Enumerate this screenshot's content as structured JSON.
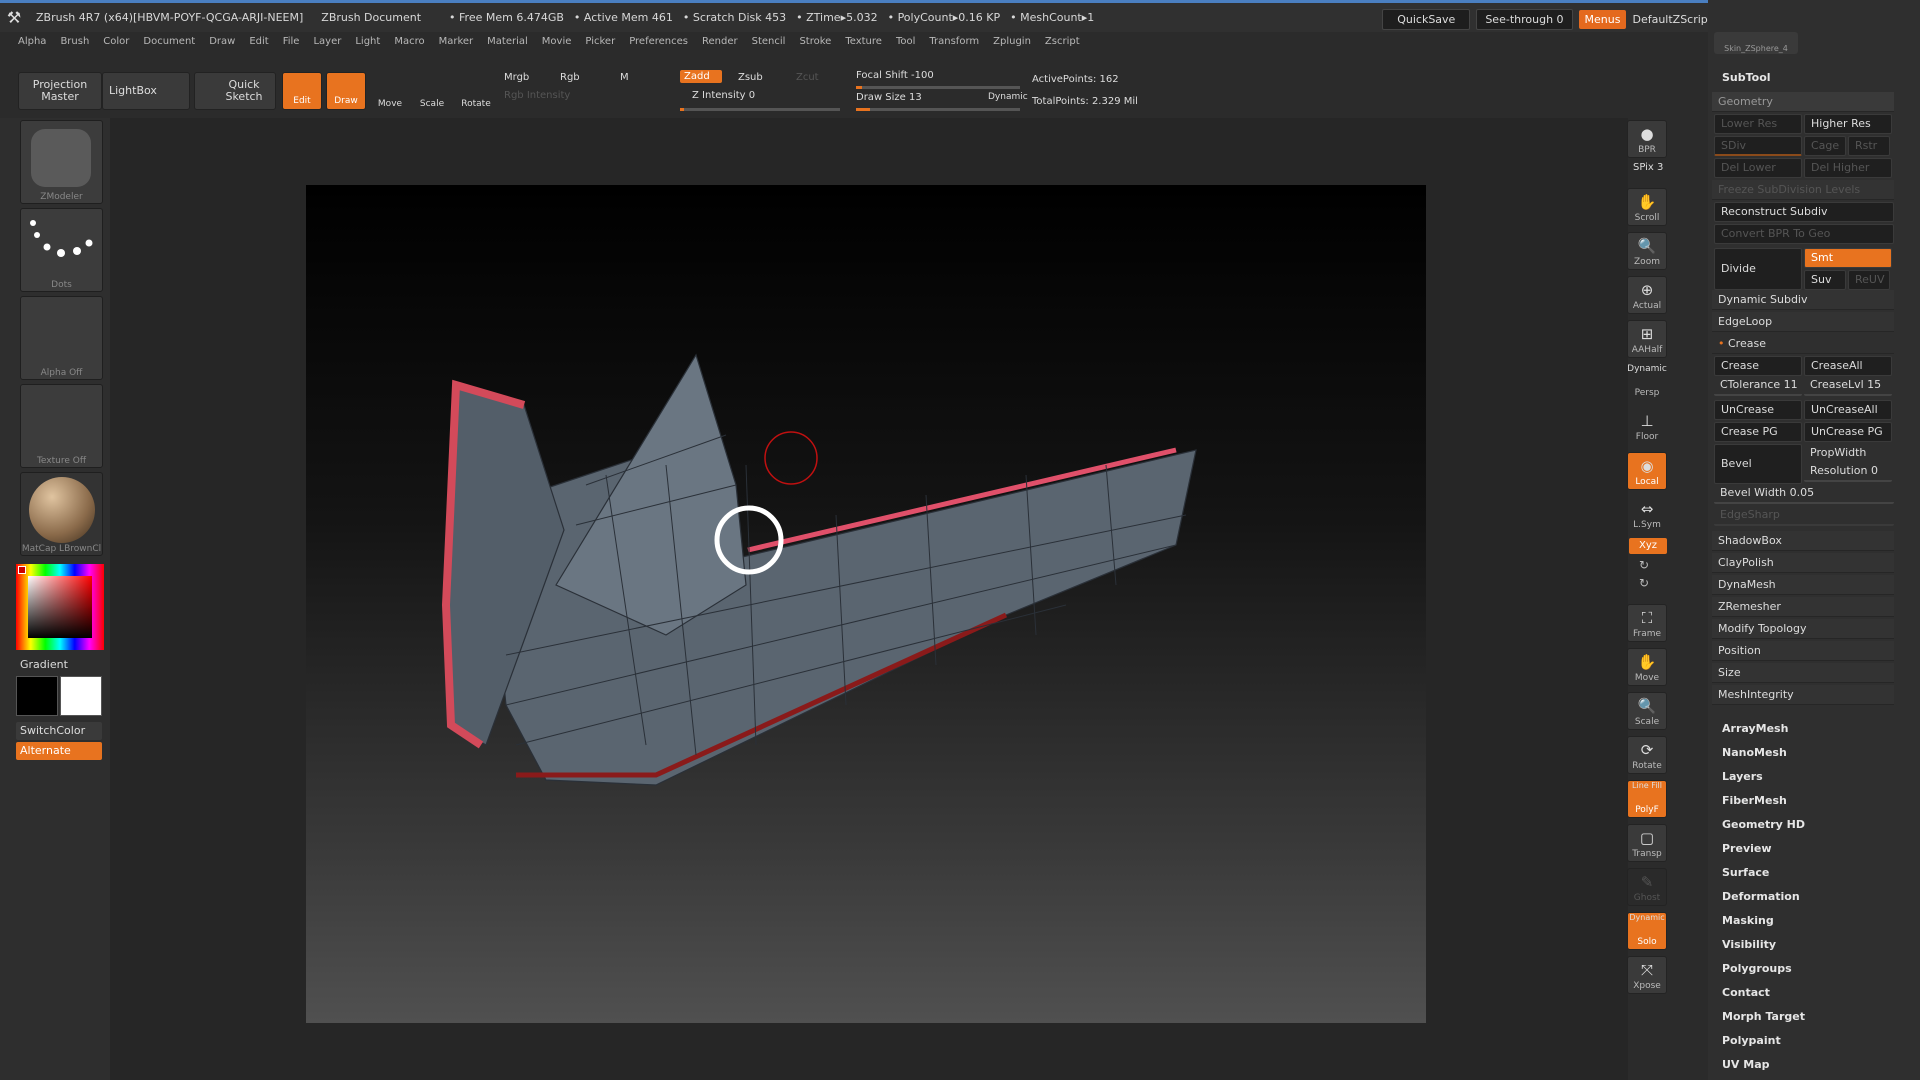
{
  "titlebar": {
    "app": "ZBrush 4R7 (x64)[HBVM-POYF-QCGA-ARJI-NEEM]",
    "doc": "ZBrush Document",
    "free_mem": "• Free Mem 6.474GB",
    "active_mem": "• Active Mem 461",
    "scratch": "• Scratch Disk 453",
    "ztime": "• ZTime▸5.032",
    "polycount": "• PolyCount▸0.16 KP",
    "meshcount": "• MeshCount▸1",
    "quicksave": "QuickSave",
    "see_through": "See-through  0",
    "menus": "Menus",
    "default_zscript": "DefaultZScript"
  },
  "menubar": [
    "Alpha",
    "Brush",
    "Color",
    "Document",
    "Draw",
    "Edit",
    "File",
    "Layer",
    "Light",
    "Macro",
    "Marker",
    "Material",
    "Movie",
    "Picker",
    "Preferences",
    "Render",
    "Stencil",
    "Stroke",
    "Texture",
    "Tool",
    "Transform",
    "Zplugin",
    "Zscript"
  ],
  "toolbar": {
    "projection_master": "Projection Master",
    "lightbox": "LightBox",
    "quick_sketch": "Quick Sketch",
    "edit": "Edit",
    "draw": "Draw",
    "move": "Move",
    "scale": "Scale",
    "rotate": "Rotate",
    "mrgb": "Mrgb",
    "rgb": "Rgb",
    "m": "M",
    "rgb_intensity": "Rgb Intensity",
    "zadd": "Zadd",
    "zsub": "Zsub",
    "zcut": "Zcut",
    "z_intensity": "Z Intensity 0",
    "focal_shift": "Focal Shift -100",
    "draw_size": "Draw Size 13",
    "dynamic": "Dynamic",
    "active_points": "ActivePoints: 162",
    "total_points": "TotalPoints: 2.329 Mil"
  },
  "left": {
    "brush_label": "ZModeler",
    "stroke_label": "Dots",
    "alpha_label": "Alpha Off",
    "texture_label": "Texture Off",
    "material_label": "MatCap LBrownCl",
    "gradient": "Gradient",
    "switch_color": "SwitchColor",
    "alternate": "Alternate"
  },
  "dock": {
    "bpr": "BPR",
    "spix": "SPix 3",
    "scroll": "Scroll",
    "zoom": "Zoom",
    "actual": "Actual",
    "aahalf": "AAHalf",
    "dynamic_persp": "Dynamic",
    "persp": "Persp",
    "floor": "Floor",
    "local": "Local",
    "lsym": "L.Sym",
    "xyz": "Xyz",
    "frame": "Frame",
    "move": "Move",
    "scale": "Scale",
    "rotate": "Rotate",
    "line_fill": "Line Fill",
    "polyf": "PolyF",
    "transp": "Transp",
    "ghost": "Ghost",
    "dynamic_solo": "Dynamic",
    "solo": "Solo",
    "xpose": "Xpose"
  },
  "panel": {
    "skin_label": "Skin_ZSphere_4",
    "subtool": "SubTool",
    "geometry": "Geometry",
    "lower_res": "Lower Res",
    "higher_res": "Higher Res",
    "sdiv": "SDiv",
    "cage": "Cage",
    "rstr": "Rstr",
    "del_lower": "Del Lower",
    "del_higher": "Del Higher",
    "freeze": "Freeze SubDivision Levels",
    "reconstruct": "Reconstruct Subdiv",
    "convert_bpr": "Convert BPR To Geo",
    "divide": "Divide",
    "smt": "Smt",
    "suv": "Suv",
    "reuv": "ReUV",
    "dynamic_subdiv": "Dynamic Subdiv",
    "edgeloop": "EdgeLoop",
    "crease_head": "Crease",
    "crease": "Crease",
    "crease_all": "CreaseAll",
    "ctolerance": "CTolerance 11",
    "crease_lvl": "CreaseLvl 15",
    "uncrease": "UnCrease",
    "uncrease_all": "UnCreaseAll",
    "crease_pg": "Crease PG",
    "uncrease_pg": "UnCrease PG",
    "bevel": "Bevel",
    "propwidth": "PropWidth",
    "resolution": "Resolution 0",
    "bevel_width": "Bevel Width 0.05",
    "edgesharp": "EdgeSharp",
    "shadowbox": "ShadowBox",
    "claypolish": "ClayPolish",
    "dynamesh": "DynaMesh",
    "zremesher": "ZRemesher",
    "modify_topology": "Modify Topology",
    "position": "Position",
    "size": "Size",
    "meshintegrity": "MeshIntegrity",
    "menus": [
      "ArrayMesh",
      "NanoMesh",
      "Layers",
      "FiberMesh",
      "Geometry HD",
      "Preview",
      "Surface",
      "Deformation",
      "Masking",
      "Visibility",
      "Polygroups",
      "Contact",
      "Morph Target",
      "Polypaint",
      "UV Map"
    ]
  }
}
